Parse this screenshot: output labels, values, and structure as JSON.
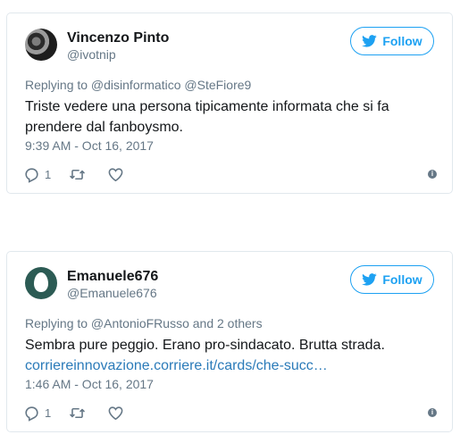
{
  "colors": {
    "accent": "#1da1f2",
    "link": "#2b7bb9",
    "muted": "#657786",
    "border": "#e1e8ed"
  },
  "tweets": [
    {
      "name": "Vincenzo Pinto",
      "handle": "@ivotnip",
      "follow_label": "Follow",
      "replying_to": "Replying to @disinformatico @SteFiore9",
      "text": "Triste vedere una persona tipicamente informata che si fa prendere dal fanboysmo.",
      "link": "",
      "timestamp": "9:39 AM - Oct 16, 2017",
      "reply_count": "1",
      "icons": [
        "bird-icon",
        "reply-icon",
        "retweet-icon",
        "heart-icon",
        "info-icon"
      ]
    },
    {
      "name": "Emanuele676",
      "handle": "@Emanuele676",
      "follow_label": "Follow",
      "replying_to": "Replying to @AntonioFRusso and 2 others",
      "text": "Sembra pure peggio. Erano pro-sindacato. Brutta strada.",
      "link": "corriereinnovazione.corriere.it/cards/che-succ…",
      "timestamp": "1:46 AM - Oct 16, 2017",
      "reply_count": "1",
      "icons": [
        "bird-icon",
        "reply-icon",
        "retweet-icon",
        "heart-icon",
        "info-icon"
      ]
    }
  ]
}
